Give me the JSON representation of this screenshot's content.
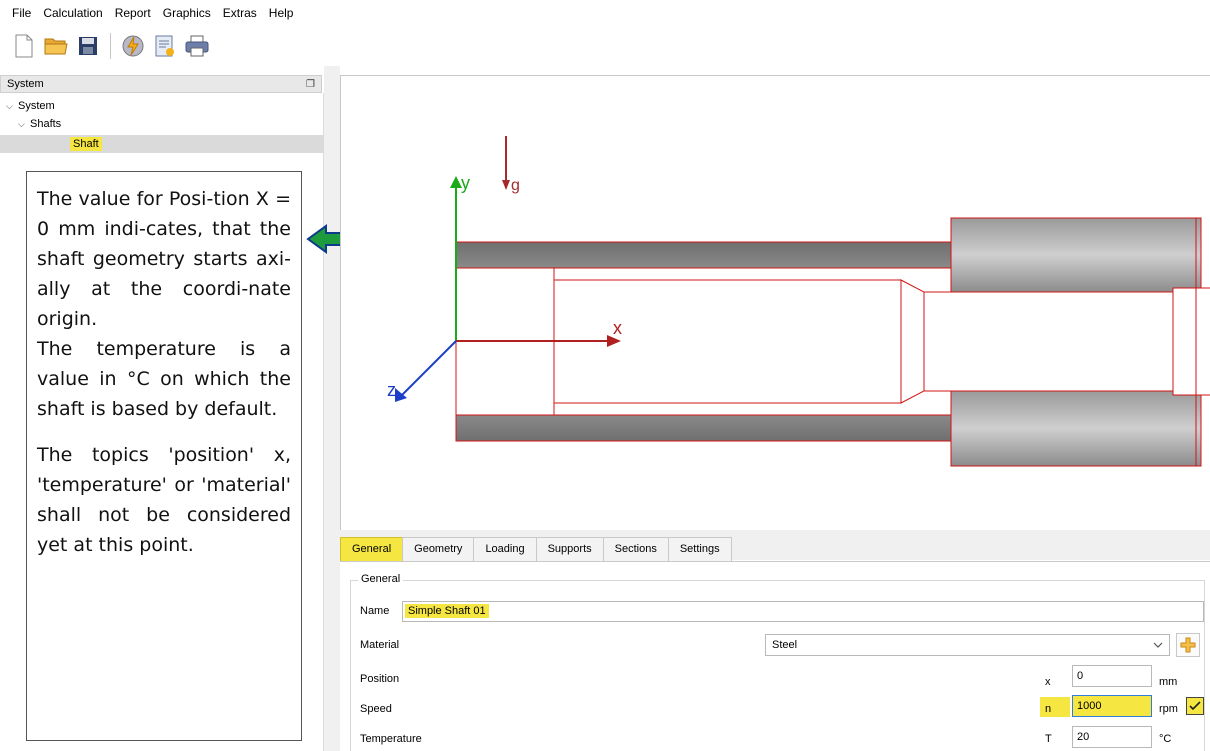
{
  "menu": [
    "File",
    "Calculation",
    "Report",
    "Graphics",
    "Extras",
    "Help"
  ],
  "toolbar": [
    {
      "icon": "new-document-icon"
    },
    {
      "icon": "open-folder-icon"
    },
    {
      "icon": "save-icon"
    },
    {
      "icon": "calculate-lightning-icon"
    },
    {
      "icon": "report-icon"
    },
    {
      "icon": "print-icon"
    }
  ],
  "system_panel": {
    "title": "System",
    "tree": [
      {
        "label": "System",
        "level": 0,
        "expanded": true
      },
      {
        "label": "Shafts",
        "level": 1,
        "expanded": true
      },
      {
        "label": "Shaft",
        "level": 2,
        "selected": true
      }
    ]
  },
  "annotation": {
    "p1": "The value for Posi-tion X = 0 mm indi-cates, that the shaft geometry starts axi-ally at the coordi-nate origin.",
    "p2": "The temperature is a value in °C on which the shaft is based by default.",
    "p3": "The topics 'position' x, 'temperature' or 'material' shall not be considered yet at this point.",
    "arrow_color": "#1e9b3c"
  },
  "graphics": {
    "axis_y": "y",
    "axis_x": "x",
    "axis_z": "z",
    "gravity": "g",
    "colors": {
      "y_axis": "#1aaa1a",
      "x_axis": "#b02020",
      "z_axis": "#1a3fc8",
      "outline": "#d01414"
    }
  },
  "tabs": {
    "items": [
      "General",
      "Geometry",
      "Loading",
      "Supports",
      "Sections",
      "Settings"
    ],
    "active": "General"
  },
  "general": {
    "group_label": "General",
    "name_label": "Name",
    "name_value": "Simple Shaft 01",
    "material_label": "Material",
    "material_value": "Steel",
    "position_label": "Position",
    "position_symbol": "x",
    "position_value": "0",
    "position_unit": "mm",
    "speed_label": "Speed",
    "speed_symbol": "n",
    "speed_value": "1000",
    "speed_unit": "rpm",
    "speed_checked": true,
    "temperature_label": "Temperature",
    "temperature_symbol": "T",
    "temperature_value": "20",
    "temperature_unit": "°C"
  },
  "highlight_color": "#f5e642"
}
